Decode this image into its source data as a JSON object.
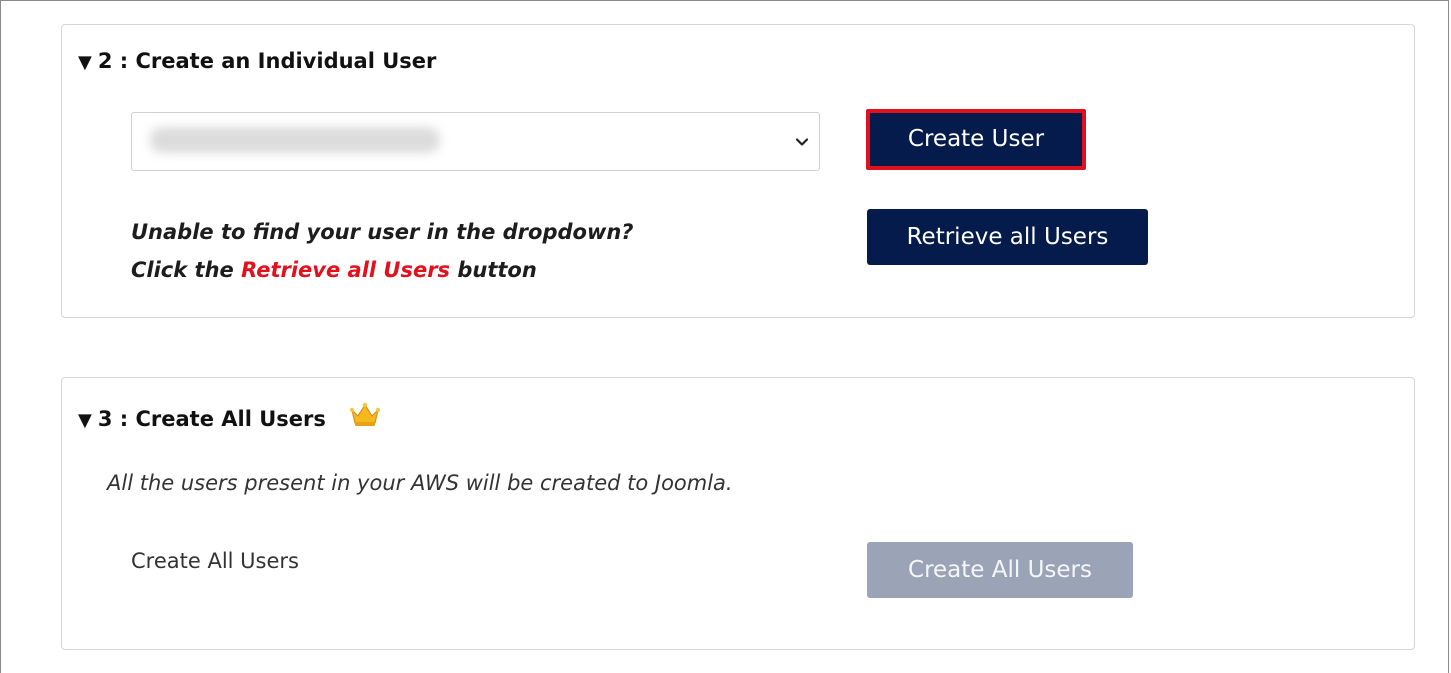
{
  "section2": {
    "toggle": "▼",
    "title": "2 : Create an Individual User",
    "create_user_button": "Create User",
    "hint_line1": "Unable to find your user in the dropdown?",
    "hint_prefix": "Click the ",
    "hint_link": "Retrieve all Users",
    "hint_suffix": " button",
    "retrieve_button": "Retrieve all Users"
  },
  "section3": {
    "toggle": "▼",
    "title": "3 : Create All Users",
    "crown_icon": "crown-icon",
    "description": "All the users present in your AWS  will be created to Joomla.",
    "row_label": "Create All Users",
    "create_all_button": "Create All Users"
  },
  "colors": {
    "primary_button": "#041b4c",
    "highlight_border": "#e0101c",
    "link_red": "#e3101e",
    "disabled_button": "#9aa4b6"
  }
}
